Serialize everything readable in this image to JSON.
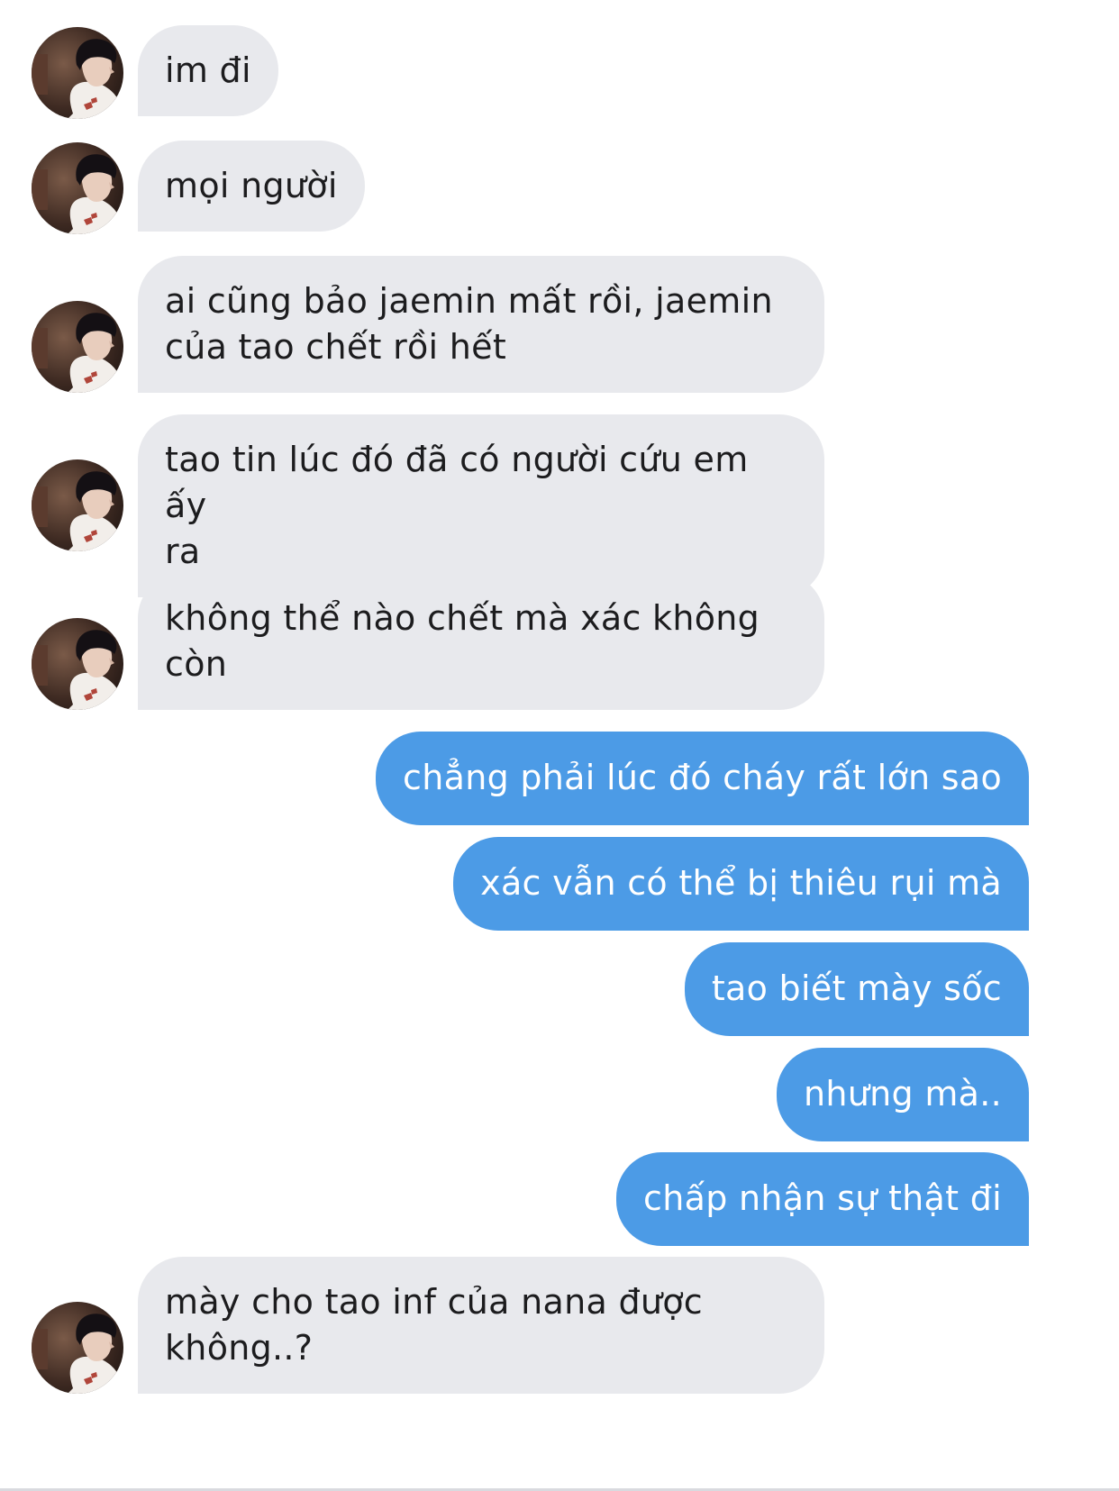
{
  "conversation": {
    "incoming_bubble_color": "#e8e9ed",
    "outgoing_bubble_color": "#4c9be6",
    "avatar_icon": "user-avatar-photo",
    "messages": [
      {
        "sender": "other",
        "text": "im đi"
      },
      {
        "sender": "other",
        "text": "mọi người"
      },
      {
        "sender": "other",
        "text": "ai cũng bảo jaemin mất rồi, jaemin\ncủa tao chết rồi hết"
      },
      {
        "sender": "other",
        "text": "tao tin lúc đó đã có người cứu em ấy\nra"
      },
      {
        "sender": "other",
        "text": "không thể nào chết mà xác không\ncòn"
      },
      {
        "sender": "me",
        "text": "chẳng phải lúc đó cháy rất lớn sao"
      },
      {
        "sender": "me",
        "text": "xác vẫn có thể bị thiêu rụi mà"
      },
      {
        "sender": "me",
        "text": "tao biết mày sốc"
      },
      {
        "sender": "me",
        "text": "nhưng mà.."
      },
      {
        "sender": "me",
        "text": "chấp nhận sự thật đi"
      },
      {
        "sender": "other",
        "text": "mày cho tao inf của nana được\nkhông..?"
      }
    ]
  }
}
